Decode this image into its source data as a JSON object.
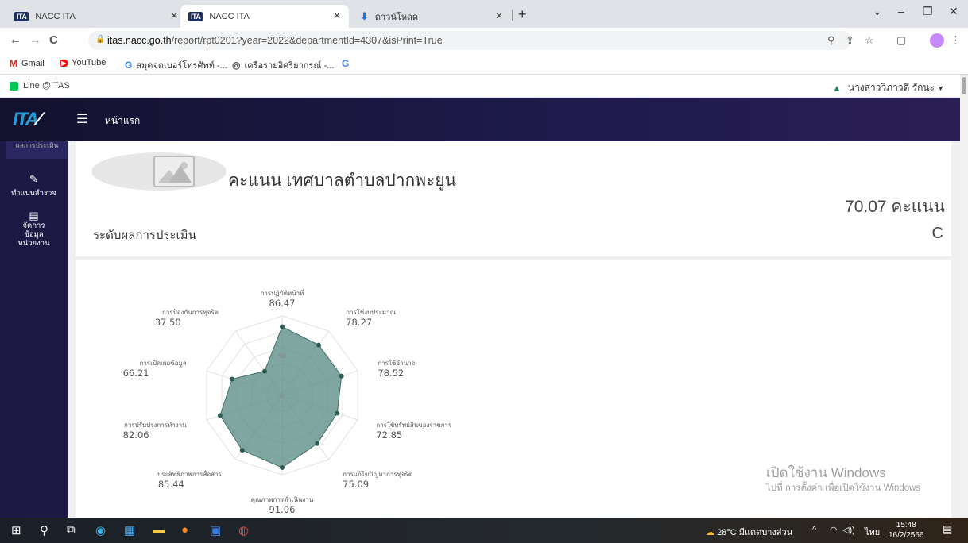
{
  "browser": {
    "tabs": [
      {
        "label": "NACC ITA",
        "favicon": "ITA"
      },
      {
        "label": "NACC ITA",
        "favicon": "ITA"
      },
      {
        "label": "ดาวน์โหลด",
        "favicon": "download"
      }
    ],
    "url_domain": "itas.nacc.go.th",
    "url_path": "/report/rpt0201?year=2022&departmentId=4307&isPrint=True",
    "bookmarks": [
      {
        "label": "Gmail",
        "icon": "M"
      },
      {
        "label": "YouTube",
        "icon": "▶"
      },
      {
        "label": "สมุดจดเบอร์โทรศัพท์ -...",
        "icon": "G"
      },
      {
        "label": "เครือรายอิศริยากรณ์ -...",
        "icon": "◎"
      },
      {
        "label": "",
        "icon": "G"
      }
    ]
  },
  "site": {
    "line_label": "Line @ITAS",
    "user_name": "นางสาววิภาวดี รักนะ",
    "logo": "ITA",
    "home_label": "หน้าแรก",
    "sidebar": [
      {
        "label": "ผลการประเมิน"
      },
      {
        "label": "ทำแบบสำรวจ"
      },
      {
        "label": "จัดการข้อมูล หน่วยงาน"
      }
    ]
  },
  "score": {
    "title": "คะแนน เทศบาลตำบลปากพะยูน",
    "value": "70.07 คะแนน",
    "level_label": "ระดับผลการประเมิน",
    "grade": "C"
  },
  "chart_data": {
    "type": "radar",
    "categories": [
      "การปฏิบัติหน้าที่",
      "การใช้งบประมาณ",
      "การใช้อำนาจ",
      "การใช้ทรัพย์สินของราชการ",
      "การแก้ไขปัญหาการทุจริต",
      "คุณภาพการดำเนินงาน",
      "ประสิทธิภาพการสื่อสาร",
      "การปรับปรุงการทำงาน",
      "การเปิดเผยข้อมูล",
      "การป้องกันการทุจริต"
    ],
    "value_labels": [
      "86.47",
      "78.27",
      "78.52",
      "72.85",
      "75.09",
      "91.06",
      "85.44",
      "82.06",
      "66.21",
      "37.50"
    ],
    "values": [
      86.47,
      78.27,
      78.52,
      72.85,
      75.09,
      91.06,
      85.44,
      82.06,
      66.21,
      37.5
    ],
    "rmin": 0,
    "rmax": 100,
    "ticks": [
      "0",
      "50"
    ],
    "fill_color": "#5f9088",
    "grid_color": "#e2e2e2"
  },
  "windows": {
    "activate_line1": "เปิดใช้งาน Windows",
    "activate_line2": "ไปที่ การตั้งค่า เพื่อเปิดใช้งาน Windows",
    "weather": "28°C มีแดดบางส่วน",
    "lang": "ไทย",
    "time": "15:48",
    "date": "16/2/2566"
  }
}
